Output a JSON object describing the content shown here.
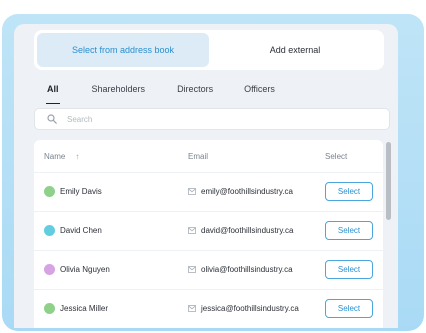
{
  "mode_toggle": {
    "address_book_label": "Select from address book",
    "external_label": "Add external"
  },
  "filter_tabs": [
    "All",
    "Shareholders",
    "Directors",
    "Officers"
  ],
  "search": {
    "placeholder": "Search"
  },
  "table": {
    "columns": {
      "name": "Name",
      "email": "Email",
      "select": "Select"
    },
    "rows": [
      {
        "name": "Emily Davis",
        "email": "emily@foothillsindustry.ca",
        "button": "Select",
        "avatar_color": "#8fd18a"
      },
      {
        "name": "David Chen",
        "email": "david@foothillsindustry.ca",
        "button": "Select",
        "avatar_color": "#63cde0"
      },
      {
        "name": "Olivia Nguyen",
        "email": "olivia@foothillsindustry.ca",
        "button": "Select",
        "avatar_color": "#d6a3e3"
      },
      {
        "name": "Jessica Miller",
        "email": "jessica@foothillsindustry.ca",
        "button": "Select",
        "avatar_color": "#8fd18a"
      }
    ]
  },
  "colors": {
    "accent": "#2a8fd0",
    "frame": "#a9daf5",
    "panel": "#eef1f5"
  }
}
